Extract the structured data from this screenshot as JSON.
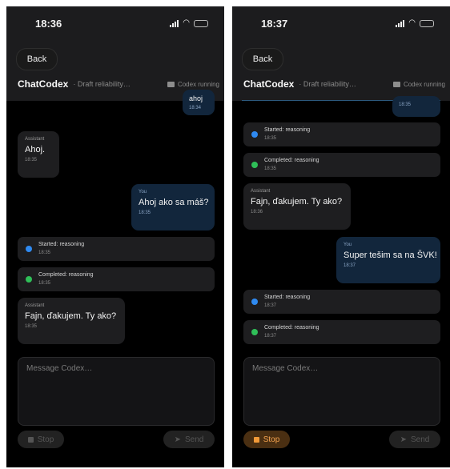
{
  "left": {
    "time": "18:36",
    "back_label": "Back",
    "app_title": "ChatCodex",
    "subtitle": "· Draft reliability…",
    "status": "Codex running",
    "messages": [
      {
        "text": "ahoj",
        "ts": "18:34"
      },
      {
        "role": "Assistant",
        "text": "Ahoj.",
        "ts": "18:35"
      },
      {
        "role": "You",
        "text": "Ahoj ako sa máš?",
        "ts": "18:35"
      },
      {
        "label": "Started: reasoning",
        "ts": "18:35"
      },
      {
        "label": "Completed: reasoning",
        "ts": "18:35"
      },
      {
        "role": "Assistant",
        "text": "Fajn, ďakujem. Ty ako?",
        "ts": "18:35"
      }
    ],
    "placeholder": "Message Codex…",
    "stop_label": "Stop",
    "send_label": "Send"
  },
  "right": {
    "time": "18:37",
    "back_label": "Back",
    "app_title": "ChatCodex",
    "subtitle": "· Draft reliability…",
    "status": "Codex running",
    "messages": [
      {
        "ts": "18:35"
      },
      {
        "label": "Started: reasoning",
        "ts": "18:35"
      },
      {
        "label": "Completed: reasoning",
        "ts": "18:35"
      },
      {
        "role": "Assistant",
        "text": "Fajn, ďakujem. Ty ako?",
        "ts": "18:36"
      },
      {
        "role": "You",
        "text": "Super tešim sa na ŠVK!",
        "ts": "18:37"
      },
      {
        "label": "Started: reasoning",
        "ts": "18:37"
      },
      {
        "label": "Completed: reasoning",
        "ts": "18:37"
      }
    ],
    "placeholder": "Message Codex…",
    "stop_label": "Stop",
    "send_label": "Send"
  },
  "colors": {
    "started_dot": "#2f8af1",
    "completed_dot": "#2fbf58",
    "user_bubble": "#12263c",
    "stop_active": "#f29a38"
  }
}
